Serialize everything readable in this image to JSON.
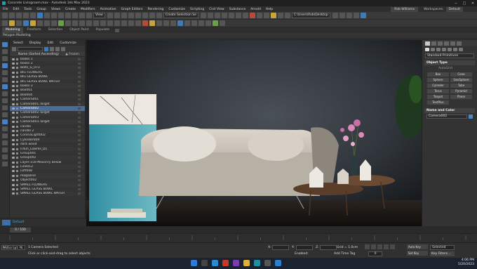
{
  "window": {
    "title": "Concrete Livingroom.max - Autodesk 3ds Max 2023"
  },
  "menu": {
    "items": [
      "File",
      "Edit",
      "Tools",
      "Group",
      "Views",
      "Create",
      "Modifiers",
      "Animation",
      "Graph Editors",
      "Rendering",
      "Customize",
      "Scripting",
      "Civil View",
      "Substance",
      "Arnold",
      "Help"
    ],
    "signin": "Rob Williams",
    "workspaces_label": "Workspaces:",
    "workspace_value": "Default"
  },
  "toolbar": {
    "view_drop": "View",
    "selection_set": "Create Selection Se",
    "project_path": "C:\\Users\\Rob\\Desktop"
  },
  "ribbon": {
    "tabs": [
      "Modeling",
      "Freeform",
      "Selection",
      "Object Paint",
      "Populate"
    ],
    "active_tab": "Modeling",
    "sub_label": "Polygon Modeling"
  },
  "scene_explorer": {
    "tabs": [
      "Select",
      "Display",
      "Edit",
      "Customize"
    ],
    "header_name": "Name (Sorted Ascending)",
    "header_frozen": "▲ Frozen",
    "rows": [
      {
        "name": "books 1",
        "selected": false
      },
      {
        "name": "books 2",
        "selected": false
      },
      {
        "name": "Bolts_G_073",
        "selected": false
      },
      {
        "name": "BIG FLOWERS",
        "selected": false
      },
      {
        "name": "BIG GLASS BOWL",
        "selected": false
      },
      {
        "name": "BIG GLASS BOWL WATER",
        "selected": false
      },
      {
        "name": "books 3",
        "selected": false
      },
      {
        "name": "Box001",
        "selected": false
      },
      {
        "name": "Box004",
        "selected": false
      },
      {
        "name": "Camera001",
        "selected": false
      },
      {
        "name": "Camera001.Target",
        "selected": false
      },
      {
        "name": "Camera002",
        "selected": true
      },
      {
        "name": "Camera002.Target",
        "selected": false
      },
      {
        "name": "Camera003",
        "selected": false
      },
      {
        "name": "Camera003.Target",
        "selected": false
      },
      {
        "name": "candle",
        "selected": false
      },
      {
        "name": "candle 2",
        "selected": false
      },
      {
        "name": "CoronaLight002",
        "selected": false
      },
      {
        "name": "Cylinder009",
        "selected": false
      },
      {
        "name": "dark wood",
        "selected": false
      },
      {
        "name": "Fillun_Lowres_D1",
        "selected": false
      },
      {
        "name": "Group001",
        "selected": false
      },
      {
        "name": "Group002",
        "selected": false
      },
      {
        "name": "Layer:150-Masonry Below",
        "selected": false
      },
      {
        "name": "Line012",
        "selected": false
      },
      {
        "name": "Loft008",
        "selected": false
      },
      {
        "name": "magazine",
        "selected": false
      },
      {
        "name": "Object002",
        "selected": false
      },
      {
        "name": "SMALL FLOWERS",
        "selected": false
      },
      {
        "name": "SMALL GLASS BOWL",
        "selected": false
      },
      {
        "name": "SMALL GLASS BOWL WATER",
        "selected": false
      }
    ]
  },
  "layer": {
    "label": "Default"
  },
  "command_panel": {
    "dropdown": "Standard Primitives",
    "object_type_title": "Object Type",
    "autogrid": "AutoGrid",
    "buttons": [
      "Box",
      "Cone",
      "Sphere",
      "GeoSphere",
      "Cylinder",
      "Tube",
      "Torus",
      "Pyramid",
      "Teapot",
      "Plane",
      "TextPlus"
    ],
    "name_color_title": "Name and Color",
    "name_value": "Camera002",
    "swatch_color": "#4a86c8"
  },
  "timeline": {
    "slider": "0 / 100"
  },
  "status": {
    "maxscript": "MAXScript Mi",
    "line1": "1 Camera Selected",
    "line2": "Click or click-and-drag to select objects",
    "x_label": "X:",
    "y_label": "Y:",
    "z_label": "Z:",
    "grid": "Grid = 1.0cm",
    "enabled": "Enabled:",
    "add_time_tag": "Add Time Tag",
    "frame": "0",
    "auto_key": "Auto Key",
    "set_key": "Set Key",
    "selected": "Selected",
    "key_filters": "Key Filters..."
  },
  "taskbar": {
    "time": "4:06 PM",
    "date": "5/20/2023"
  }
}
